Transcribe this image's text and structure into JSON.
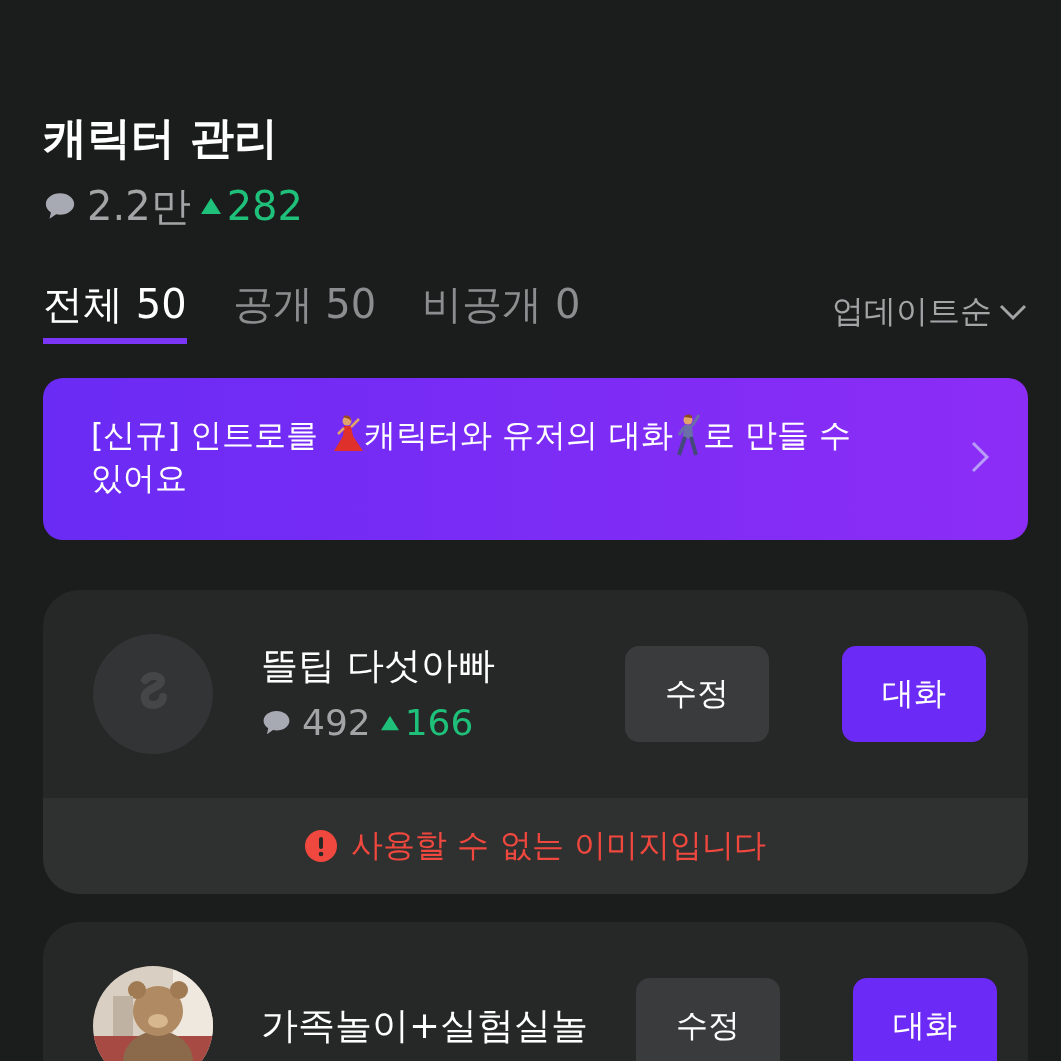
{
  "header": {
    "title": "캐릭터 관리",
    "chat_count": "2.2만",
    "likes": "282"
  },
  "tabs": [
    {
      "label": "전체 50",
      "selected": true
    },
    {
      "label": "공개 50",
      "selected": false
    },
    {
      "label": "비공개 0",
      "selected": false
    }
  ],
  "sort": {
    "label": "업데이트순"
  },
  "banner": {
    "text_parts": [
      "[신규] 인트로를 ",
      "캐릭터와 유저의 대화",
      "로 만들 수 있어요"
    ]
  },
  "characters": [
    {
      "name": "뜰팁 다섯아빠",
      "avatar": {
        "kind": "placeholder"
      },
      "chat_count": "492",
      "likes": "166",
      "edit_label": "수정",
      "chat_label": "대화",
      "error": "사용할 수 없는 이미지입니다"
    },
    {
      "name": "가족놀이+실험실놀",
      "edit_label": "수정",
      "chat_label": "대화"
    }
  ]
}
